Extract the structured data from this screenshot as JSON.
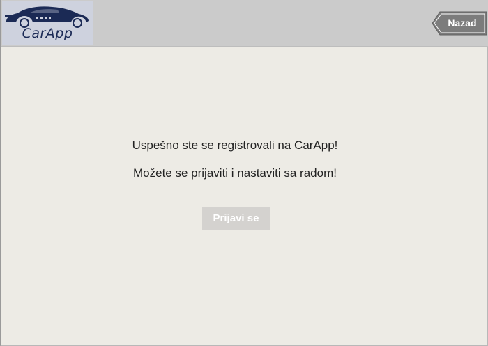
{
  "header": {
    "logo_text": "CarApp",
    "back_label": "Nazad"
  },
  "main": {
    "message_line1": "Uspešno ste se registrovali na CarApp!",
    "message_line2": "Možete se prijaviti i nastaviti sa radom!",
    "login_label": "Prijavi se"
  },
  "colors": {
    "background": "#edebe5",
    "header": "#cbcbcb",
    "logo_bg": "#ced2de",
    "logo_navy": "#1b2a55",
    "back_button": "#7c7c7c",
    "login_button": "#d4d2cf"
  },
  "icons": {
    "logo": "car-silhouette-icon"
  }
}
